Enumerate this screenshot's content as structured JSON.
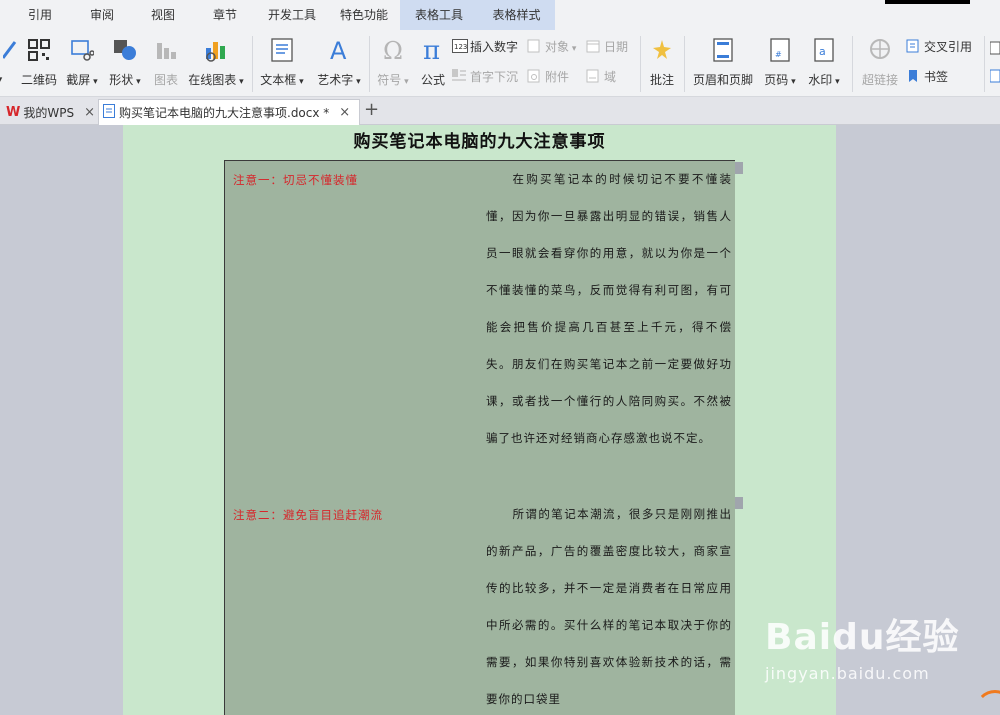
{
  "menu": {
    "tabs": [
      {
        "label": "引用",
        "context": false
      },
      {
        "label": "审阅",
        "context": false
      },
      {
        "label": "视图",
        "context": false
      },
      {
        "label": "章节",
        "context": false
      },
      {
        "label": "开发工具",
        "context": false
      },
      {
        "label": "特色功能",
        "context": false
      },
      {
        "label": "表格工具",
        "context": true
      },
      {
        "label": "表格样式",
        "context": true
      }
    ]
  },
  "ribbon": {
    "qrcode": "二维码",
    "screenshot": "截屏",
    "shape": "形状",
    "chart": "图表",
    "online_chart": "在线图表",
    "textbox": "文本框",
    "wordart": "艺术字",
    "symbol": "符号",
    "formula": "公式",
    "insert_number": "插入数字",
    "object": "对象",
    "date": "日期",
    "dropcap": "首字下沉",
    "attachment": "附件",
    "field": "域",
    "comment": "批注",
    "header_footer": "页眉和页脚",
    "page_number": "页码",
    "watermark": "水印",
    "hyperlink": "超链接",
    "cross_ref": "交叉引用",
    "bookmark": "书签"
  },
  "doctabs": {
    "home": "我的WPS",
    "file": "购买笔记本电脑的九大注意事项.docx *"
  },
  "document": {
    "title": "购买笔记本电脑的九大注意事项",
    "rows": [
      {
        "label": "注意一：切忌不懂装懂",
        "text": "在购买笔记本的时候切记不要不懂装懂，因为你一旦暴露出明显的错误，销售人员一眼就会看穿你的用意，就以为你是一个不懂装懂的菜鸟，反而觉得有利可图，有可能会把售价提高几百甚至上千元，得不偿失。朋友们在购买笔记本之前一定要做好功课，或者找一个懂行的人陪同购买。不然被骗了也许还对经销商心存感激也说不定。"
      },
      {
        "label": "注意二：避免盲目追赶潮流",
        "text": "所谓的笔记本潮流，很多只是刚刚推出的新产品，广告的覆盖密度比较大，商家宣传的比较多，并不一定是消费者在日常应用中所必需的。买什么样的笔记本取决于你的需要，如果你特别喜欢体验新技术的话，需要你的口袋里"
      }
    ]
  },
  "watermark": {
    "logo": "Baidu经验",
    "url": "jingyan.baidu.com"
  },
  "colors": {
    "page_bg": "#c9e7cc",
    "cell_bg": "#9fb49f",
    "label_red": "#d6262b",
    "workspace": "#c7cad4"
  }
}
